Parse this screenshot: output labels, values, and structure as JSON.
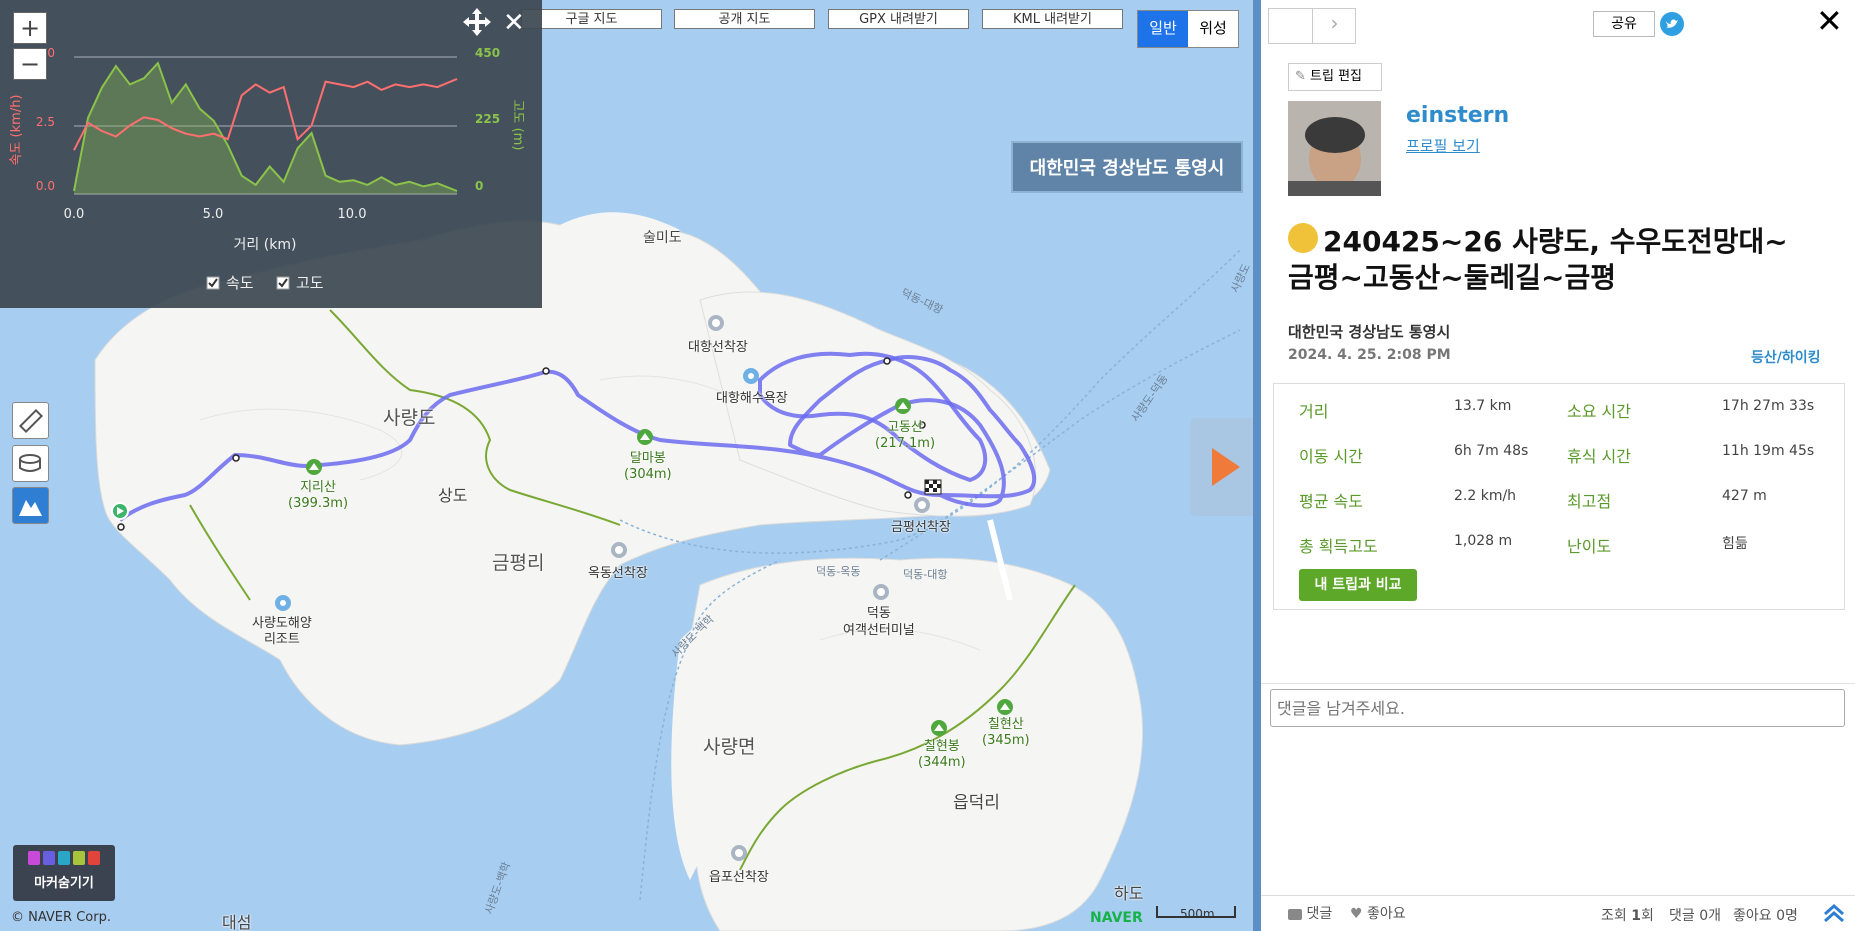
{
  "map": {
    "top_buttons": [
      "구글 지도",
      "공개 지도",
      "GPX 내려받기",
      "KML 내려받기"
    ],
    "map_types": [
      {
        "label": "일반",
        "active": true
      },
      {
        "label": "위성",
        "active": false
      }
    ],
    "region_badge": "대한민국 경상남도 통영시",
    "zoom_in": "+",
    "zoom_out": "−",
    "close_glyph": "✕",
    "marker_hide_label": "마커숨기기",
    "copyright": "© NAVER Corp.",
    "naver_logo": "NAVER",
    "scale_label": "500m",
    "labels": {
      "sulmido": "술미도",
      "daehang_pier": "대항선착장",
      "daehang_beach": "대항해수욕장",
      "saryangdo": "사량도",
      "sangdo": "상도",
      "jirisan": "지리산",
      "jirisan_h": "(399.3m)",
      "dalmabong": "달마봉",
      "dalmabong_h": "(304m)",
      "godongsan": "고동산",
      "godongsan_h": "(217.1m)",
      "geumpyeong_pier": "금평선착장",
      "geumpyeongri": "금평리",
      "okdong_pier": "옥동선착장",
      "resort1": "사량도해양",
      "resort2": "리조트",
      "deokdong1": "덕동",
      "deokdong2": "여객선터미널",
      "saryangmyeon": "사량면",
      "chilhyeonbong": "칠현봉",
      "chilhyeonbong_h": "(344m)",
      "chilhyeonsan": "칠현산",
      "chilhyeonsan_h": "(345m)",
      "eupdeokri": "읍덕리",
      "eupo_pier": "읍포선착장",
      "hado": "하도",
      "daeseom": "대섬",
      "ferry_deokdong_daehang": "덕동-대항",
      "ferry_deokdong_okdong": "덕동-옥동",
      "ferry_deokdong_daehang2": "덕동-대항",
      "ferry_saryang_baekhak": "사량도-백학",
      "ferry_saryang_deokdong": "사량도-덕동",
      "ferry_saryang_right": "사량도",
      "ferry_baekhak_bottom": "사량도-백학"
    }
  },
  "chart": {
    "xlabel": "거리 (km)",
    "y_left_label": "속도 (km/h)",
    "y_right_label": "고도 (m)",
    "x_ticks": [
      "0.0",
      "5.0",
      "10.0"
    ],
    "y_left_ticks": [
      "5.0",
      "2.5",
      "0.0"
    ],
    "y_right_ticks": [
      "450",
      "225",
      "0"
    ],
    "checkbox_speed": "속도",
    "checkbox_altitude": "고도",
    "speed_color": "#ff6f6f",
    "altitude_color": "#8bc34a",
    "chart_data": {
      "type": "line",
      "x": [
        0,
        0.5,
        1,
        1.5,
        2,
        2.5,
        3,
        3.5,
        4,
        4.5,
        5,
        5.5,
        6,
        6.5,
        7,
        7.5,
        8,
        8.5,
        9,
        9.5,
        10,
        10.5,
        11,
        11.5,
        12,
        12.5,
        13,
        13.7
      ],
      "series": [
        {
          "name": "속도",
          "axis": "left",
          "values": [
            1.6,
            2.6,
            2.3,
            2.1,
            2.5,
            2.8,
            2.7,
            2.4,
            2.2,
            2.1,
            2.2,
            2.0,
            3.6,
            4.0,
            3.7,
            3.9,
            2.0,
            2.5,
            4.1,
            4.0,
            3.9,
            4.1,
            3.8,
            4.0,
            3.9,
            4.0,
            3.9,
            4.2
          ]
        },
        {
          "name": "고도",
          "axis": "right",
          "values": [
            10,
            250,
            350,
            420,
            360,
            380,
            430,
            300,
            360,
            280,
            240,
            160,
            60,
            30,
            90,
            40,
            150,
            200,
            60,
            40,
            45,
            30,
            55,
            30,
            40,
            25,
            35,
            10
          ]
        }
      ],
      "xlim": [
        0,
        13.7
      ],
      "ylim_left": [
        0,
        5
      ],
      "ylim_right": [
        0,
        450
      ]
    }
  },
  "panel": {
    "share_label": "공유",
    "edit_trip_label": "트립 편집",
    "username": "einstern",
    "profile_link": "프로필 보기",
    "title_line1": "240425~26 사량도, 수우도전망대~",
    "title_line2": "금평~고동산~둘레길~금평",
    "location": "대한민국 경상남도 통영시",
    "datetime": "2024. 4. 25. 2:08 PM",
    "category": "등산/하이킹",
    "stats": [
      {
        "label": "거리",
        "value": "13.7 km",
        "label2": "소요 시간",
        "value2": "17h 27m 33s"
      },
      {
        "label": "이동 시간",
        "value": "6h 7m 48s",
        "label2": "휴식 시간",
        "value2": "11h 19m 45s"
      },
      {
        "label": "평균 속도",
        "value": "2.2 km/h",
        "label2": "최고점",
        "value2": "427 m"
      },
      {
        "label": "총 획득고도",
        "value": "1,028 m",
        "label2": "난이도",
        "value2": "힘듦"
      }
    ],
    "compare_button": "내 트립과 비교",
    "comment_placeholder": "댓글을 남겨주세요.",
    "footer": {
      "comment_label": "댓글",
      "like_label": "좋아요",
      "views_prefix": "조회 ",
      "views": "1",
      "views_suffix": "회",
      "comments_count": "댓글 0개",
      "likes_count": "좋아요 0명"
    }
  }
}
